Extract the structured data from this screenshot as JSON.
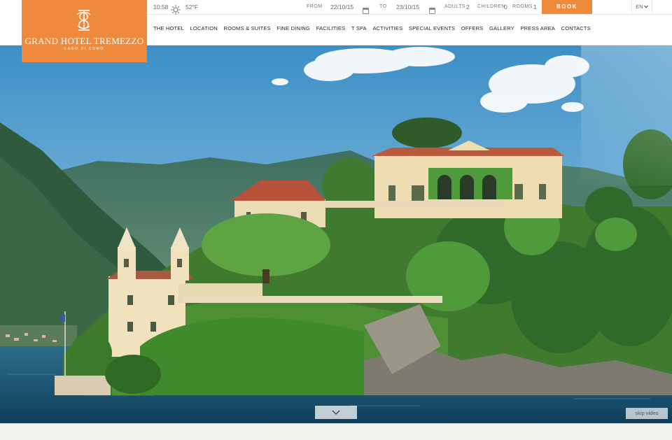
{
  "brand": {
    "name": "GRAND HOTEL TREMEZZO",
    "subtitle": "LAGO DI COMO",
    "color": "#ef8a3c",
    "icon": "monogram-logo"
  },
  "weather": {
    "time": "10:58",
    "temperature": "52°F",
    "icon": "sun-icon"
  },
  "booking": {
    "from_label": "FROM",
    "from_date": "22/10/15",
    "to_label": "TO",
    "to_date": "23/10/15",
    "adults_label": "ADULTS",
    "adults_count": "2",
    "children_label": "CHILDREN",
    "children_count": "0",
    "rooms_label": "ROOMS",
    "rooms_count": "1",
    "book_label": "BOOK",
    "calendar_icon": "calendar-icon"
  },
  "language": {
    "selected": "EN",
    "icon": "chevron-down-icon"
  },
  "nav": {
    "items": [
      "THE HOTEL",
      "LOCATION",
      "ROOMS & SUITES",
      "FINE DINING",
      "FACILITIES",
      "T SPA",
      "ACTIVITIES",
      "SPECIAL EVENTS",
      "OFFERS",
      "GALLERY",
      "PRESS AREA",
      "CONTACTS"
    ]
  },
  "hero": {
    "skip_label": "skip video",
    "scroll_icon": "chevron-down-icon"
  }
}
